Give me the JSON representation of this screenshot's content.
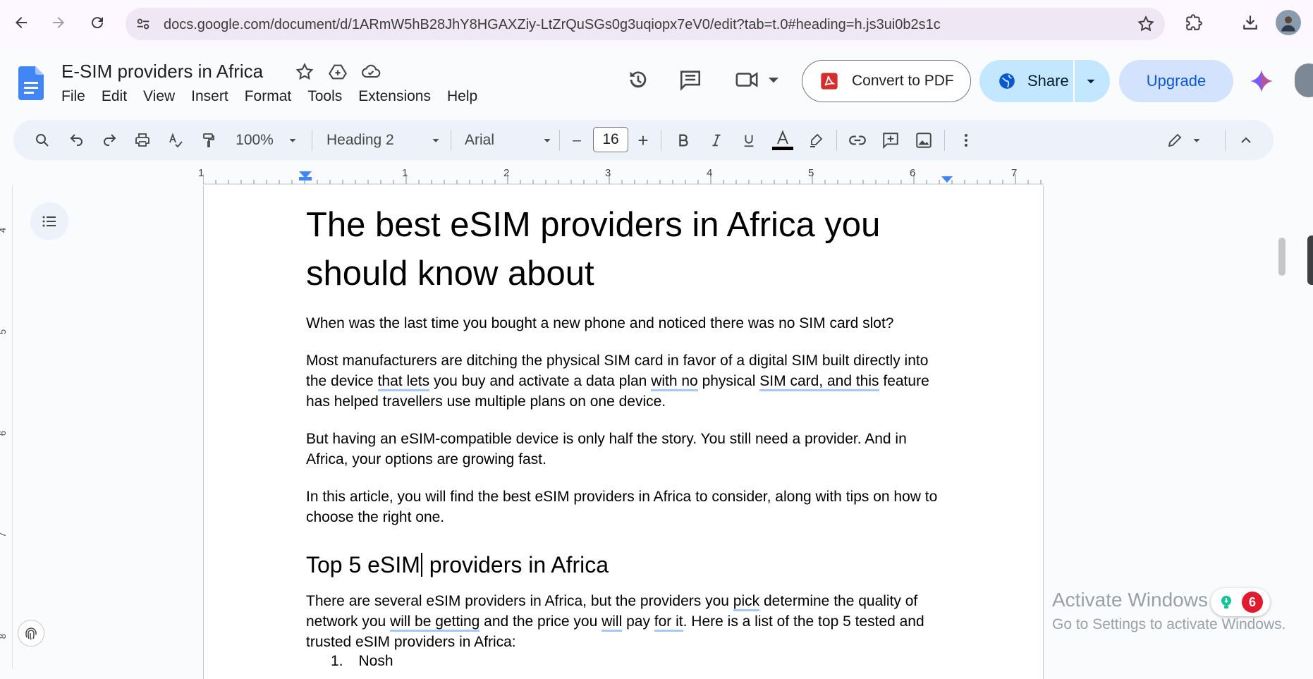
{
  "browser": {
    "url": "docs.google.com/document/d/1ARmW5hB28JhY8HGAXZiy-LtZrQuSGs0g3uqiopx7eV0/edit?tab=t.0#heading=h.js3ui0b2s1c"
  },
  "header": {
    "doc_title": "E-SIM providers in Africa",
    "menu": [
      "File",
      "Edit",
      "View",
      "Insert",
      "Format",
      "Tools",
      "Extensions",
      "Help"
    ],
    "convert_label": "Convert to PDF",
    "share_label": "Share",
    "upgrade_label": "Upgrade"
  },
  "toolbar": {
    "zoom": "100%",
    "style": "Heading 2",
    "font": "Arial",
    "font_size": "16",
    "minus": "–",
    "plus": "+"
  },
  "ruler": {
    "numbers": [
      "1",
      "1",
      "2",
      "3",
      "4",
      "5",
      "6",
      "7"
    ]
  },
  "vruler": {
    "numbers": [
      "4",
      "5",
      "6",
      "7",
      "8"
    ]
  },
  "document": {
    "title": "The best eSIM providers in Africa you should know about",
    "p1": "When was the last time you bought a new phone and noticed there was no SIM card slot?",
    "p2": {
      "a": "Most manufacturers are ditching the physical SIM card in favor of a digital SIM built directly into the device ",
      "b": "that lets",
      "c": " you buy and activate a data plan ",
      "d": "with no",
      "e": " physical ",
      "f": "SIM card, and this",
      "g": " feature has helped travellers use multiple plans on one device."
    },
    "p3": "But having an eSIM-compatible device is only half the story. You still need a provider. And in Africa, your options are growing fast.",
    "p4": "In this article, you will find the best eSIM providers in Africa to consider, along with tips on how to choose the right one.",
    "h2_a": "Top 5 eSIM",
    "h2_b": " providers in Africa",
    "p5": {
      "a": "There are several eSIM providers in Africa, but the providers you ",
      "b": "pick",
      "c": " determine the quality of network you ",
      "d": "will be getting",
      "e": " and the price you ",
      "f": "will",
      "g": " pay ",
      "h": "for it",
      "i": ". Here is a list of the top 5 tested and trusted eSIM providers in Africa:"
    },
    "list_num": "1.",
    "list_item": "Nosh"
  },
  "watermark": {
    "title": "Activate Windows",
    "subtitle": "Go to Settings to activate Windows."
  },
  "grammarly": {
    "count": "6"
  },
  "colors": {
    "accent": "#0b57d0",
    "share_bg": "#c2e7ff",
    "upgrade_bg": "#d3e3fd",
    "docs_blue": "#4285f4"
  }
}
